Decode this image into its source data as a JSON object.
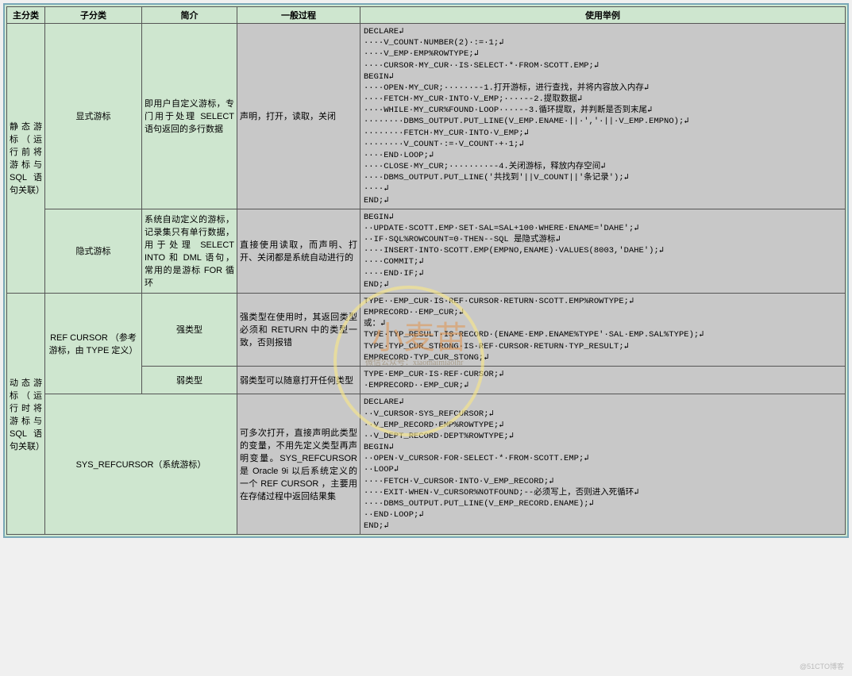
{
  "headers": {
    "c1": "主分类",
    "c2": "子分类",
    "c3": "简介",
    "c4": "一般过程",
    "c5": "使用举例"
  },
  "main": {
    "static": "静态游标（运行前将游标与 SQL 语句关联）",
    "dynamic": "动态游标（运行时将游标与 SQL 语句关联）"
  },
  "rows": {
    "r1": {
      "sub": "显式游标",
      "intro": "即用户自定义游标，专门用于处理 SELECT 语句返回的多行数据",
      "proc": "声明，打开，读取，关闭",
      "code": "DECLARE↲\n····V_COUNT·NUMBER(2)·:=·1;↲\n····V_EMP·EMP%ROWTYPE;↲\n····CURSOR·MY_CUR··IS·SELECT·*·FROM·SCOTT.EMP;↲\nBEGIN↲\n····OPEN·MY_CUR;······--1.打开游标，进行查找，并将内容放入内存↲\n····FETCH·MY_CUR·INTO·V_EMP;····--2.提取数据↲\n····WHILE·MY_CUR%FOUND·LOOP····--3.循环提取，并判断是否到末尾↲\n········DBMS_OUTPUT.PUT_LINE(V_EMP.ENAME·||·','·||·V_EMP.EMPNO);↲\n········FETCH·MY_CUR·INTO·V_EMP;↲\n········V_COUNT·:=·V_COUNT·+·1;↲\n····END·LOOP;↲\n····CLOSE·MY_CUR;········--4.关闭游标，释放内存空间↲\n····DBMS_OUTPUT.PUT_LINE('共找到'||V_COUNT||'条记录');↲\n····↲\nEND;↲"
    },
    "r2": {
      "sub": "隐式游标",
      "intro": "系统自动定义的游标，记录集只有单行数据，用于处理 SELECT INTO 和 DML 语句，常用的是游标 FOR 循环",
      "proc": "直接使用读取，而声明、打开、关闭都是系统自动进行的",
      "code": "BEGIN↲\n··UPDATE·SCOTT.EMP·SET·SAL=SAL+100·WHERE·ENAME='DAHE';↲\n··IF·SQL%ROWCOUNT=0·THEN--SQL 是隐式游标↲\n····INSERT·INTO·SCOTT.EMP(EMPNO,ENAME)·VALUES(8003,'DAHE');↲\n····COMMIT;↲\n····END·IF;↲\nEND;↲"
    },
    "r3": {
      "sub": "REF CURSOR （参考游标，由 TYPE 定义）",
      "intro_a": "强类型",
      "proc_a": "强类型在使用时，其返回类型必须和 RETURN 中的类型一致，否则报错",
      "code_a": "TYPE··EMP_CUR·IS·REF·CURSOR·RETURN·SCOTT.EMP%ROWTYPE;↲\nEMPRECORD··EMP_CUR;↲\n或：↲\nTYPE·TYP_RESULT·IS·RECORD·(ENAME·EMP.ENAME%TYPE'·SAL·EMP.SAL%TYPE);↲\nTYPE·TYP_CUR_STRONG·IS·REF·CURSOR·RETURN·TYP_RESULT;↲\nEMPRECORD·TYP_CUR_STONG;↲",
      "intro_b": "弱类型",
      "proc_b": "弱类型可以随意打开任何类型",
      "code_b": "TYPE·EMP_CUR·IS·REF·CURSOR;↲\n·EMPRECORD··EMP_CUR;↲"
    },
    "r4": {
      "sub": "SYS_REFCURSOR（系统游标）",
      "proc": "可多次打开，直接声明此类型的变量，不用先定义类型再声明变量。SYS_REFCURSOR 是 Oracle 9i 以后系统定义的一个 REF CURSOR ，主要用在存储过程中返回结果集",
      "code": "DECLARE↲\n··V_CURSOR·SYS_REFCURSOR;↲\n··V_EMP_RECORD·EMP%ROWTYPE;↲\n··V_DEPT_RECORD·DEPT%ROWTYPE;↲\nBEGIN↲\n··OPEN·V_CURSOR·FOR·SELECT·*·FROM·SCOTT.EMP;↲\n··LOOP↲\n····FETCH·V_CURSOR·INTO·V_EMP_RECORD;↲\n····EXIT·WHEN·V_CURSOR%NOTFOUND;--必须写上，否则进入死循环↲\n····DBMS_OUTPUT.PUT_LINE(V_EMP_RECORD.ENAME);↲\n··END·LOOP;↲\nEND;↲"
    }
  },
  "watermark": {
    "main": "小麦苗",
    "sub": "微信公众号：xiaomaimiaolhr",
    "corner": "@51CTO博客"
  }
}
